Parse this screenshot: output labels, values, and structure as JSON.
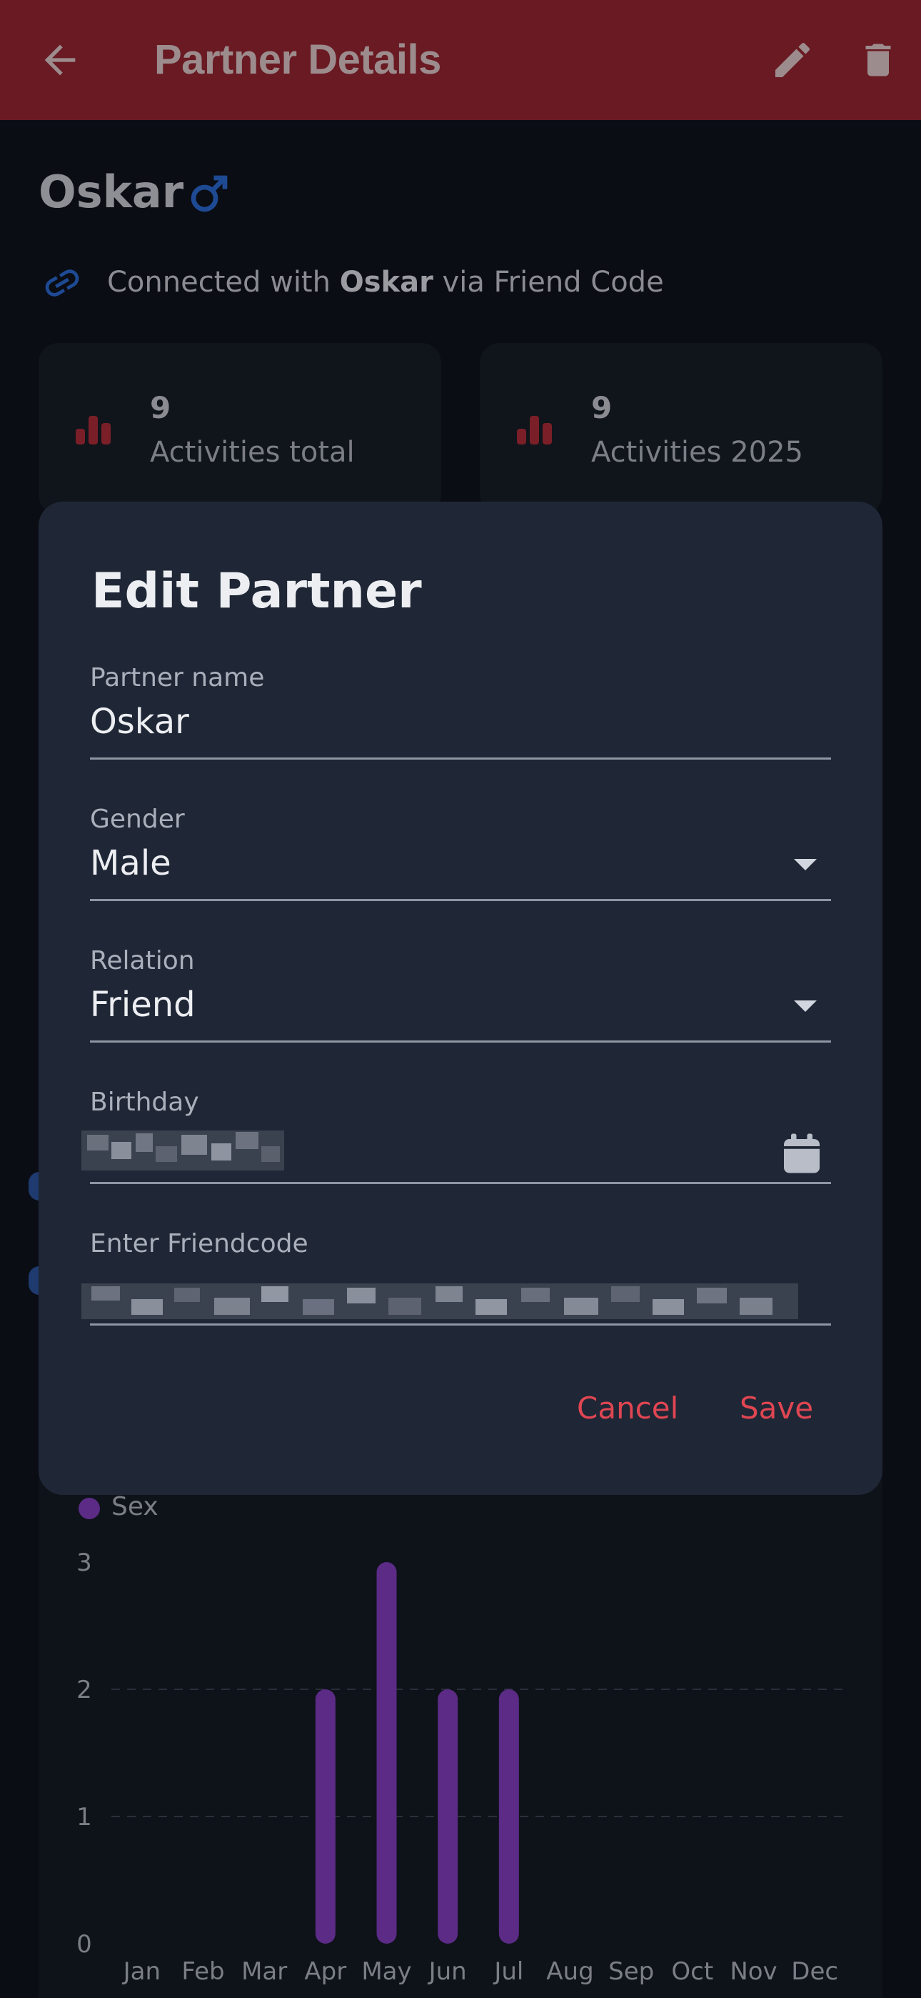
{
  "appbar": {
    "title": "Partner Details",
    "back_icon": "arrow-left-icon",
    "edit_icon": "pencil-icon",
    "delete_icon": "trash-icon",
    "color": "#6a1a22"
  },
  "partner": {
    "name": "Oskar",
    "gender_icon": "male-icon",
    "connection": {
      "prefix": "Connected with",
      "name": "Oskar",
      "suffix": "via Friend Code"
    }
  },
  "stats": [
    {
      "value": "9",
      "label": "Activities total"
    },
    {
      "value": "9",
      "label": "Activities 2025"
    }
  ],
  "dialog": {
    "title": "Edit Partner",
    "fields": {
      "name": {
        "label": "Partner name",
        "value": "Oskar"
      },
      "gender": {
        "label": "Gender",
        "value": "Male"
      },
      "relation": {
        "label": "Relation",
        "value": "Friend"
      },
      "birthday": {
        "label": "Birthday"
      },
      "friendcode": {
        "label": "Enter Friendcode"
      }
    },
    "cancel_label": "Cancel",
    "save_label": "Save",
    "accent": "#e04652"
  },
  "chart_data": {
    "type": "bar",
    "categories": [
      "Jan",
      "Feb",
      "Mar",
      "Apr",
      "May",
      "Jun",
      "Jul",
      "Aug",
      "Sep",
      "Oct",
      "Nov",
      "Dec"
    ],
    "series": [
      {
        "name": "Sex",
        "values": [
          0,
          0,
          0,
          2,
          3,
          2,
          2,
          0,
          0,
          0,
          0,
          0
        ],
        "color": "#5b2b86"
      }
    ],
    "ylim": [
      0,
      3
    ],
    "yticks": [
      "0",
      "1",
      "2",
      "3"
    ],
    "grid": true,
    "legend": "top-left"
  }
}
